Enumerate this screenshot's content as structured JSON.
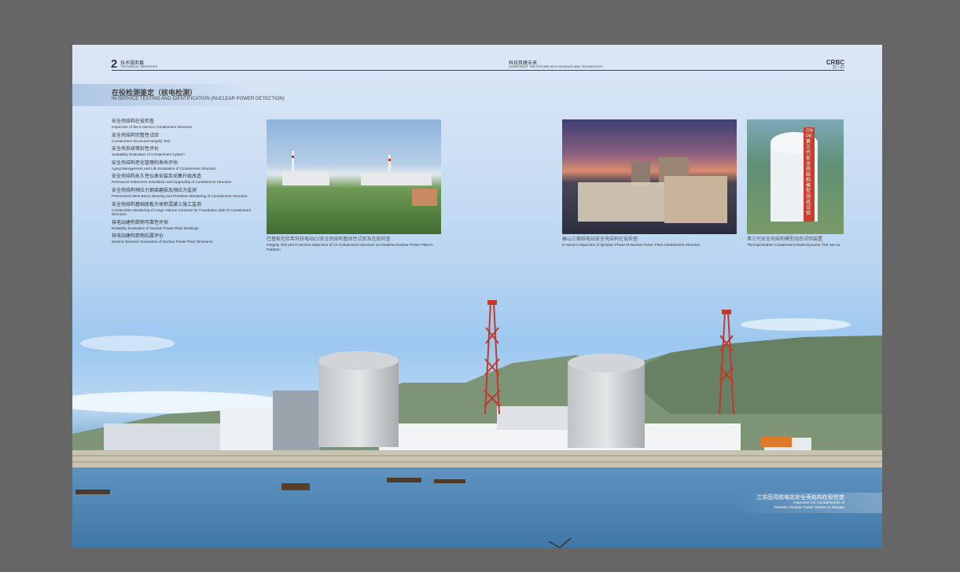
{
  "header": {
    "chapter_number": "2",
    "chapter_cn": "技术服务篇",
    "chapter_en": "TECHNICAL SERVICES",
    "middle_cn": "科技筑建未来",
    "middle_en": "CONSTRUCT THE FUTURE WITH SCIENCE AND TECHNOLOGY",
    "brand": "CRBC",
    "page_numbers": "21 / 22"
  },
  "section": {
    "title_cn": "在役检测鉴定（核电检测）",
    "title_en": "IN-SERVICE TESTING AND IDENTIFICATION (NUCLEAR POWER DETECTION)"
  },
  "items": [
    {
      "cn": "安全壳结构在役检查",
      "en": "Inspection of the In-service Containment Structure"
    },
    {
      "cn": "安全壳结构完整性试验",
      "en": "Containment Structural Integrity Test"
    },
    {
      "cn": "安全壳系统密封性评价",
      "en": "Sealability Evaluation of Containment System"
    },
    {
      "cn": "安全壳结构老化管理和寿命评估",
      "en": "Aging Management and Life Evaluation of Containment Structure"
    },
    {
      "cn": "安全壳结构永久性仪表安装及采集升级改造",
      "en": "Permanent Instrument Installation and Upgrading of Containment Structure"
    },
    {
      "cn": "安全壳结构预应力钢束磨损及预应力监测",
      "en": "Prestressed Steel Beam Wearing and Prestress Monitoring of Containment Structure"
    },
    {
      "cn": "安全壳结构基础底板大体积混凝土施工监测",
      "en": "Construction Monitoring of Large Volume Concrete for Foundation Slab of Containment Structure"
    },
    {
      "cn": "核电站建构筑物可靠性评估",
      "en": "Reliability Evaluation of Nuclear Power Plant Buildings"
    },
    {
      "cn": "核电站建构筑物抗震评价",
      "en": "Seismic Behavior Evaluation of Nuclear Power Plant Structures"
    }
  ],
  "photos": [
    {
      "cn": "巴基斯坦恰希玛核电站C2安全壳结构整体性试验及在役检查",
      "en": "Integrity Test and In-service Inspection of C2 Containment Structure at Chashma Nuclear Power Plant in Pakistan"
    },
    {
      "cn": "秦山三期核电站安全壳结构在役检查",
      "en": "In-service Inspection of Qinshan Phase III Nuclear Power Plant Containment Structure"
    },
    {
      "cn": "第三代安全壳结构模型动态试验装置",
      "en": "Third-generation Containment Model Dynamic Test Set-up"
    }
  ],
  "sign_text": "CNPE第三代安全壳结构模型动态试验",
  "bottom_caption": {
    "cn": "江苏田湾核电站安全壳结构在役检查",
    "en_line1": "Inspection for Containments of",
    "en_line2": "Tianwan Nuclear Power Station in Jiangsu"
  },
  "colors": {
    "background": "#666666",
    "text": "#333333",
    "tower_red": "#c0392b"
  }
}
